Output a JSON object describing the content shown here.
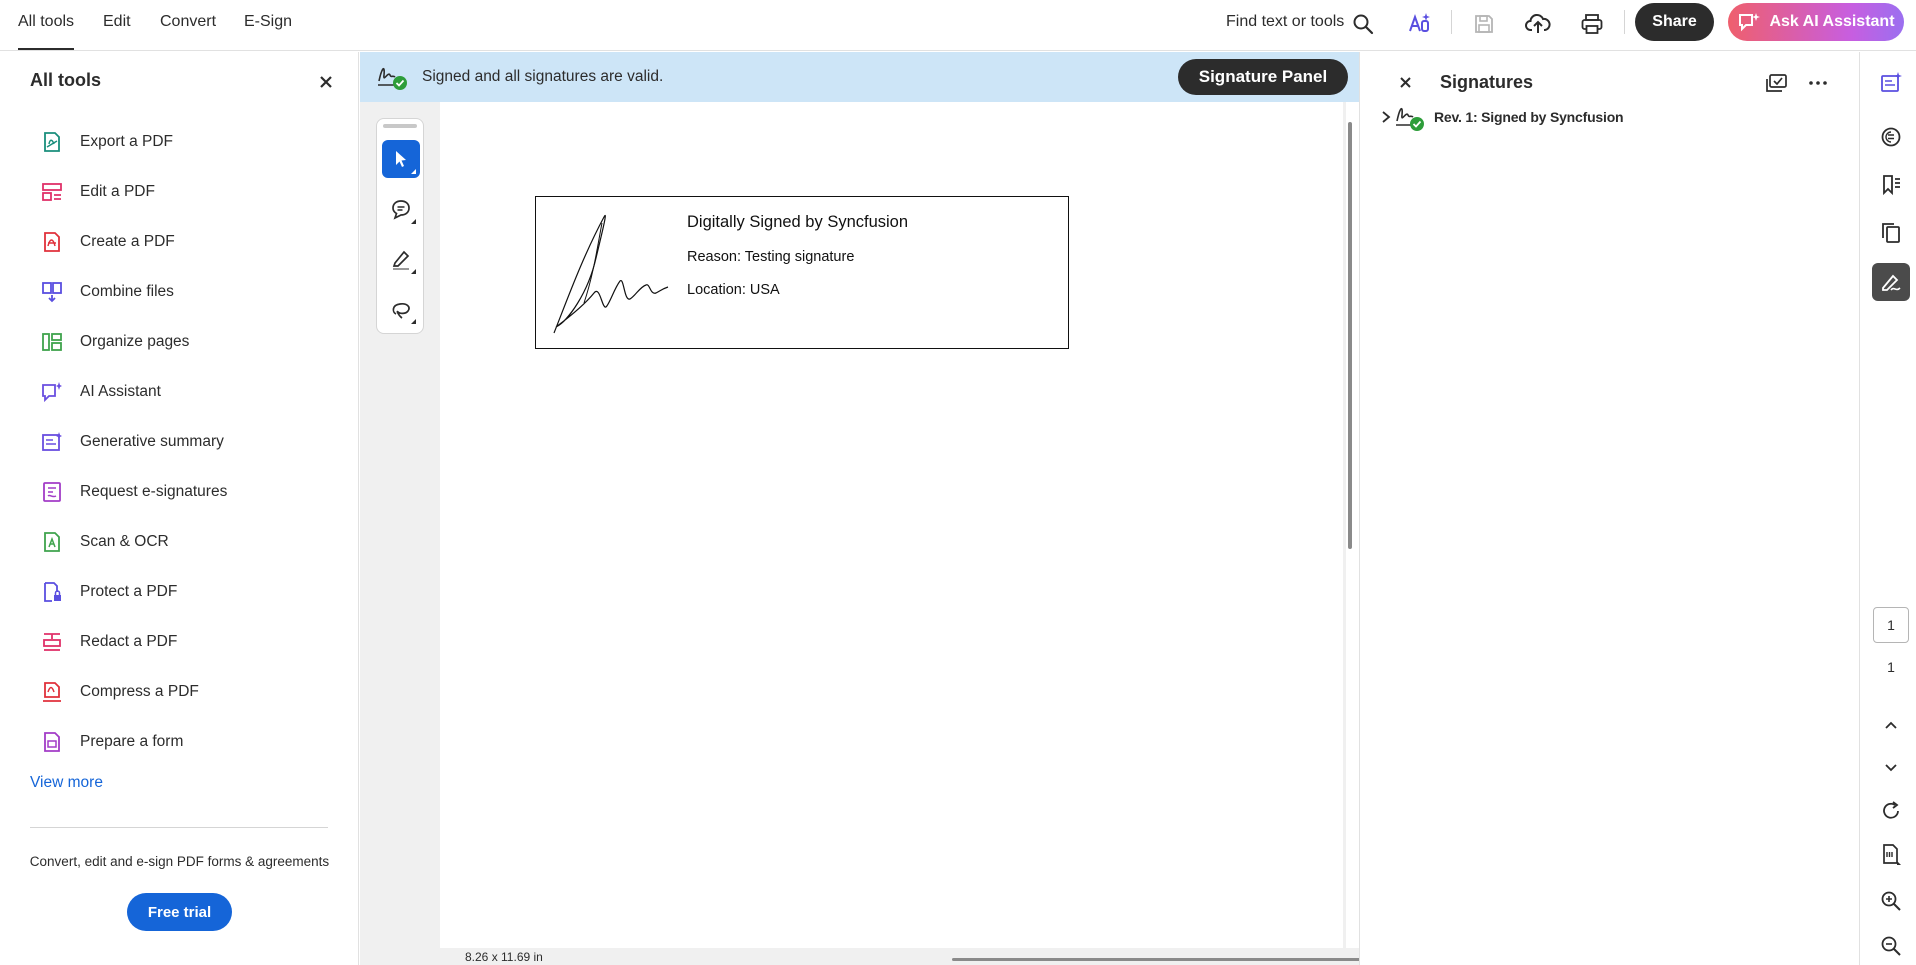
{
  "menu": {
    "tabs": [
      "All tools",
      "Edit",
      "Convert",
      "E-Sign"
    ],
    "active_tab": "All tools"
  },
  "toolbar": {
    "find_label": "Find text or tools",
    "share_label": "Share",
    "ai_label": "Ask AI Assistant",
    "icons": [
      "search-icon",
      "ai-assistant-icon",
      "save-icon",
      "upload-icon",
      "print-icon"
    ]
  },
  "left_panel": {
    "title": "All tools",
    "tools": [
      {
        "label": "Export a PDF",
        "icon": "export-pdf-icon",
        "color": "#1a8e7c"
      },
      {
        "label": "Edit a PDF",
        "icon": "edit-pdf-icon",
        "color": "#e0316a"
      },
      {
        "label": "Create a PDF",
        "icon": "create-pdf-icon",
        "color": "#e0313b"
      },
      {
        "label": "Combine files",
        "icon": "combine-files-icon",
        "color": "#5a4fe0"
      },
      {
        "label": "Organize pages",
        "icon": "organize-pages-icon",
        "color": "#3fa34d"
      },
      {
        "label": "AI Assistant",
        "icon": "ai-assistant-icon",
        "color": "#6a4fe0"
      },
      {
        "label": "Generative summary",
        "icon": "generative-summary-icon",
        "color": "#6a4fe0"
      },
      {
        "label": "Request e-signatures",
        "icon": "request-esignatures-icon",
        "color": "#a23cc7"
      },
      {
        "label": "Scan & OCR",
        "icon": "scan-ocr-icon",
        "color": "#3fa34d"
      },
      {
        "label": "Protect a PDF",
        "icon": "protect-pdf-icon",
        "color": "#5a4fe0"
      },
      {
        "label": "Redact a PDF",
        "icon": "redact-pdf-icon",
        "color": "#e0316a"
      },
      {
        "label": "Compress a PDF",
        "icon": "compress-pdf-icon",
        "color": "#e0313b"
      },
      {
        "label": "Prepare a form",
        "icon": "prepare-form-icon",
        "color": "#a23cc7"
      }
    ],
    "view_more": "View more",
    "promo_text": "Convert, edit and e-sign PDF forms & agreements",
    "free_trial": "Free trial"
  },
  "banner": {
    "text": "Signed and all signatures are valid.",
    "button": "Signature Panel"
  },
  "document": {
    "signature_lines": [
      "Digitally Signed by Syncfusion",
      "Reason: Testing signature",
      "Location: USA"
    ],
    "page_size": "8.26 x 11.69 in"
  },
  "signatures_panel": {
    "title": "Signatures",
    "revision": "Rev. 1: Signed by Syncfusion"
  },
  "page_nav": {
    "current_page": "1",
    "total_pages": "1"
  },
  "colors": {
    "accent": "#1565d8",
    "banner": "#cde5f7",
    "valid": "#2d9d3a"
  }
}
